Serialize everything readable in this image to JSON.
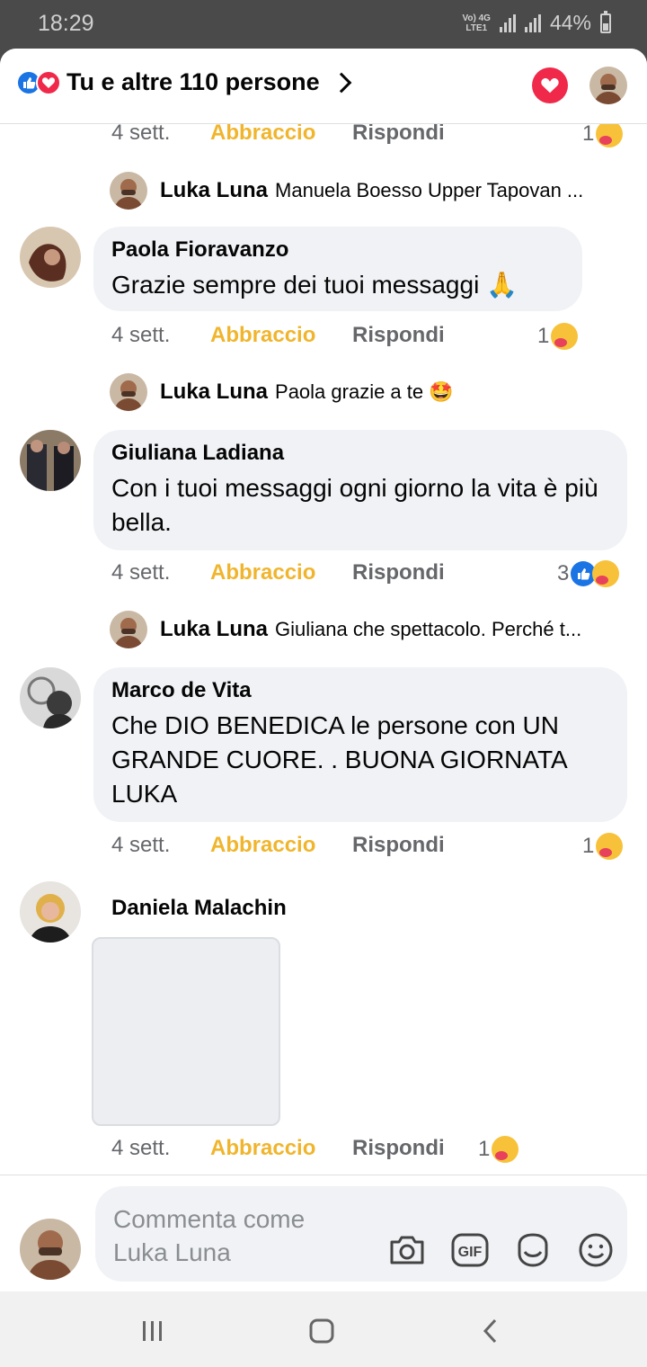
{
  "status_bar": {
    "time": "18:29",
    "network_top": "Vo) 4G",
    "network_bottom": "LTE1",
    "battery": "44%"
  },
  "header": {
    "reactions_summary": "Tu e altre 110 persone",
    "reaction_icons": [
      "like-icon",
      "love-icon"
    ],
    "heart_button_icon": "heart-icon"
  },
  "comments": [
    {
      "author": "",
      "text": "",
      "time": "4 sett.",
      "hug_label": "Abbraccio",
      "reply_label": "Rispondi",
      "reaction_count": "1",
      "reactions": [
        "hug"
      ],
      "reply": {
        "author": "Luka Luna",
        "text": "Manuela Boesso Upper Tapovan ..."
      }
    },
    {
      "author": "Paola Fioravanzo",
      "text": "Grazie sempre dei tuoi messaggi 🙏",
      "time": "4 sett.",
      "hug_label": "Abbraccio",
      "reply_label": "Rispondi",
      "reaction_count": "1",
      "reactions": [
        "hug"
      ],
      "reply": {
        "author": "Luka Luna",
        "text": "Paola grazie a te 🤩"
      }
    },
    {
      "author": "Giuliana Ladiana",
      "text": "Con i tuoi messaggi ogni giorno la vita è più bella.",
      "time": "4 sett.",
      "hug_label": "Abbraccio",
      "reply_label": "Rispondi",
      "reaction_count": "3",
      "reactions": [
        "like",
        "hug"
      ],
      "reply": {
        "author": "Luka Luna",
        "text": "Giuliana che spettacolo. Perché t..."
      }
    },
    {
      "author": "Marco de Vita",
      "text": "Che DIO BENEDICA le persone con UN GRANDE CUORE.   . BUONA GIORNATA LUKA",
      "time": "4 sett.",
      "hug_label": "Abbraccio",
      "reply_label": "Rispondi",
      "reaction_count": "1",
      "reactions": [
        "hug"
      ]
    },
    {
      "author": "Daniela Malachin",
      "text": "",
      "time": "4 sett.",
      "hug_label": "Abbraccio",
      "reply_label": "Rispondi",
      "reaction_count": "1",
      "reactions": [
        "hug"
      ]
    }
  ],
  "composer": {
    "placeholder": "Commenta come Luka Luna",
    "icons": [
      "camera-icon",
      "gif-icon",
      "sticker-icon",
      "emoji-icon"
    ]
  },
  "nav_bar": {
    "buttons": [
      "recent-apps-icon",
      "home-icon",
      "back-icon"
    ]
  }
}
